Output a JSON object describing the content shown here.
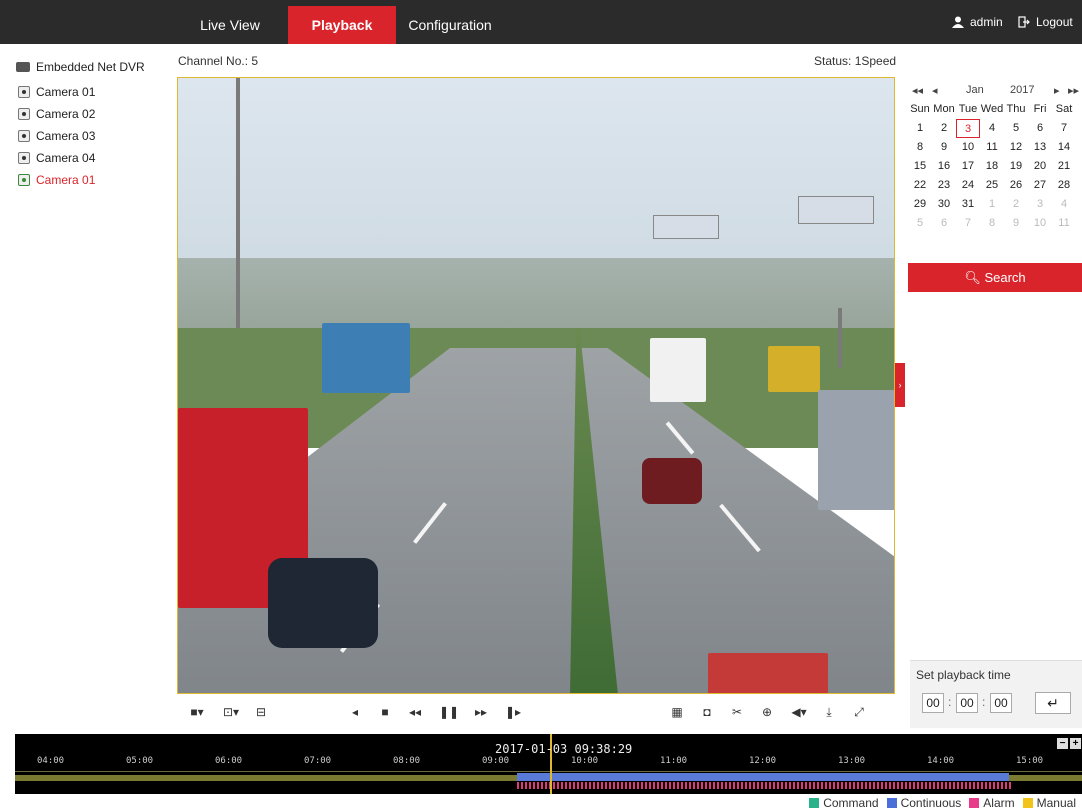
{
  "nav": {
    "tabs": [
      "Live View",
      "Playback",
      "Configuration"
    ],
    "active_tab": "Playback",
    "user": "admin",
    "logout": "Logout"
  },
  "sidebar": {
    "device": "Embedded Net DVR",
    "cameras": [
      "Camera 01",
      "Camera 02",
      "Camera 03",
      "Camera 04",
      "Camera 01"
    ]
  },
  "header": {
    "channel": "Channel No.: 5",
    "status": "Status: 1Speed"
  },
  "calendar": {
    "month": "Jan",
    "year": "2017",
    "weekdays": [
      "Sun",
      "Mon",
      "Tue",
      "Wed",
      "Thu",
      "Fri",
      "Sat"
    ],
    "days": [
      [
        "1",
        "2",
        "3",
        "4",
        "5",
        "6",
        "7"
      ],
      [
        "8",
        "9",
        "10",
        "11",
        "12",
        "13",
        "14"
      ],
      [
        "15",
        "16",
        "17",
        "18",
        "19",
        "20",
        "21"
      ],
      [
        "22",
        "23",
        "24",
        "25",
        "26",
        "27",
        "28"
      ],
      [
        "29",
        "30",
        "31",
        "1",
        "2",
        "3",
        "4"
      ],
      [
        "5",
        "6",
        "7",
        "8",
        "9",
        "10",
        "11"
      ]
    ],
    "selected_day": "3",
    "search": "Search"
  },
  "playback_time": {
    "title": "Set playback time",
    "hh": "00",
    "mm": "00",
    "ss": "00"
  },
  "timeline": {
    "current": "2017-01-03 09:38:29",
    "ticks": [
      "04:00",
      "05:00",
      "06:00",
      "07:00",
      "08:00",
      "09:00",
      "10:00",
      "11:00",
      "12:00",
      "13:00",
      "14:00",
      "15:00"
    ]
  },
  "legend": [
    "Command",
    "Continuous",
    "Alarm",
    "Manual"
  ],
  "colors": {
    "accent": "#d9242b",
    "command": "#2ab28a",
    "continuous": "#4a6fd8",
    "alarm": "#e83c8a",
    "manual": "#f2c31a"
  },
  "icons": {
    "controls_left": [
      "window-layout-icon",
      "stream-icon",
      "sync-icon"
    ],
    "controls_center": [
      "reverse-play-icon",
      "stop-icon",
      "slow-icon",
      "pause-icon",
      "fast-icon",
      "frame-step-icon"
    ],
    "controls_right": [
      "clip-icon",
      "snapshot-icon",
      "cut-icon",
      "zoom-icon",
      "volume-icon",
      "download-icon",
      "fullscreen-icon"
    ]
  }
}
